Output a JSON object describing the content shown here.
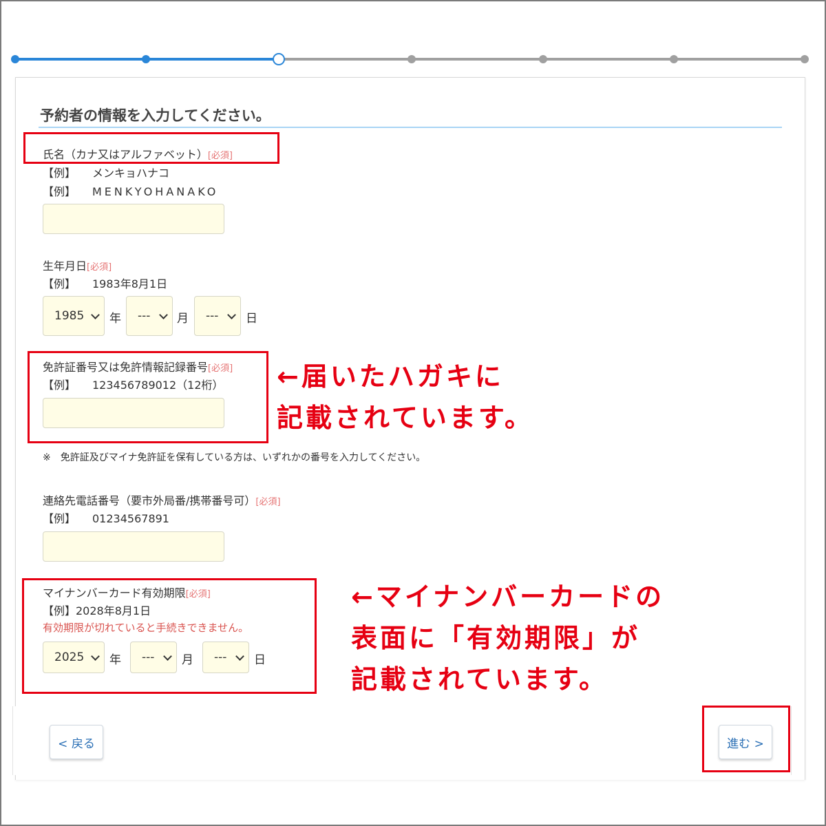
{
  "colors": {
    "progress_active": "#2a86d8",
    "progress_inactive": "#a0a0a0",
    "title_rule": "#a8d4f5",
    "input_bg": "#fffde6",
    "required": "#e57373",
    "annotation": "#e60012",
    "link": "#2a6fb5"
  },
  "progress": {
    "current_step": 3,
    "total_steps": 7
  },
  "form": {
    "title": "予約者の情報を入力してください。",
    "required_mark": "[必須]",
    "name": {
      "label": "氏名（カナ又はアルファベット）",
      "example_tag": "【例】",
      "example1": "メンキョハナコ",
      "example2": "MENKYOHANAKO",
      "value": ""
    },
    "birthdate": {
      "label": "生年月日",
      "example_tag": "【例】",
      "example": "1983年8月1日",
      "year": "1985",
      "year_unit": "年",
      "month": "---",
      "month_unit": "月",
      "day": "---",
      "day_unit": "日"
    },
    "license": {
      "label": "免許証番号又は免許情報記録番号",
      "example_tag": "【例】",
      "example": "123456789012（12桁）",
      "value": "",
      "note": "※　免許証及びマイナ免許証を保有している方は、いずれかの番号を入力してください。"
    },
    "phone": {
      "label": "連絡先電話番号（要市外局番/携帯番号可）",
      "example_tag": "【例】",
      "example": "01234567891",
      "value": ""
    },
    "mynumber_expiry": {
      "label": "マイナンバーカード有効期限",
      "example": "【例】2028年8月1日",
      "warning": "有効期限が切れていると手続きできません。",
      "year": "2025",
      "year_unit": "年",
      "month": "---",
      "month_unit": "月",
      "day": "---",
      "day_unit": "日"
    }
  },
  "annotations": {
    "license_line1": "←届いたハガキに",
    "license_line2": "記載されています。",
    "expiry_line1": "←マイナンバーカードの",
    "expiry_line2": "表面に「有効期限」が",
    "expiry_line3": "記載されています。"
  },
  "footer": {
    "back_label": "< 戻る",
    "next_label": "進む >"
  }
}
